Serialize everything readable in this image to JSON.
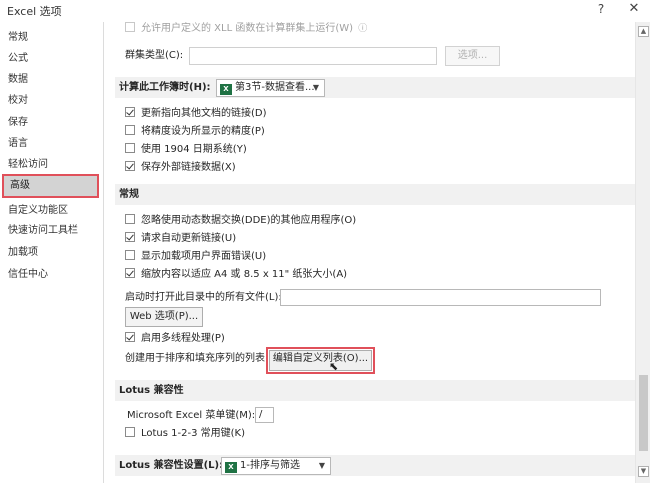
{
  "window": {
    "title": "Excel 选项",
    "help": "?",
    "close": "✕"
  },
  "sidebar": {
    "items": [
      {
        "label": "常规"
      },
      {
        "label": "公式"
      },
      {
        "label": "数据"
      },
      {
        "label": "校对"
      },
      {
        "label": "保存"
      },
      {
        "label": "语言"
      },
      {
        "label": "轻松访问"
      },
      {
        "label": "高级"
      },
      {
        "label": "自定义功能区"
      },
      {
        "label": "快速访问工具栏"
      },
      {
        "label": "加载项"
      },
      {
        "label": "信任中心"
      }
    ],
    "active_index": 7
  },
  "top": {
    "xll_label": "允许用户定义的 XLL 函数在计算群集上运行(W)",
    "cluster_type_label": "群集类型(C):",
    "options_button": "选项..."
  },
  "calc": {
    "header": "计算此工作簿时(H):",
    "workbook": "第3节-数据查看...",
    "options": [
      {
        "label": "更新指向其他文档的链接(D)",
        "checked": true
      },
      {
        "label": "将精度设为所显示的精度(P)",
        "checked": false
      },
      {
        "label": "使用 1904 日期系统(Y)",
        "checked": false
      },
      {
        "label": "保存外部链接数据(X)",
        "checked": true
      }
    ]
  },
  "general": {
    "header": "常规",
    "options": [
      {
        "label": "忽略使用动态数据交换(DDE)的其他应用程序(O)",
        "checked": false
      },
      {
        "label": "请求自动更新链接(U)",
        "checked": true
      },
      {
        "label": "显示加载项用户界面错误(U)",
        "checked": false
      },
      {
        "label": "缩放内容以适应 A4 或 8.5 x 11\" 纸张大小(A)",
        "checked": true
      }
    ],
    "startup_label": "启动时打开此目录中的所有文件(L):",
    "web_options_button": "Web 选项(P)...",
    "multithread_label": "启用多线程处理(P)",
    "multithread_checked": true,
    "custom_list_label": "创建用于排序和填充序列的列表:",
    "edit_custom_list_button": "编辑自定义列表(O)..."
  },
  "lotus": {
    "header": "Lotus 兼容性",
    "menu_key_label": "Microsoft Excel 菜单键(M):",
    "menu_key_value": "/",
    "nav_keys_label": "Lotus 1-2-3 常用键(K)",
    "nav_keys_checked": false
  },
  "lotus_settings": {
    "header": "Lotus 兼容性设置(L):",
    "sheet": "1-排序与筛选"
  }
}
